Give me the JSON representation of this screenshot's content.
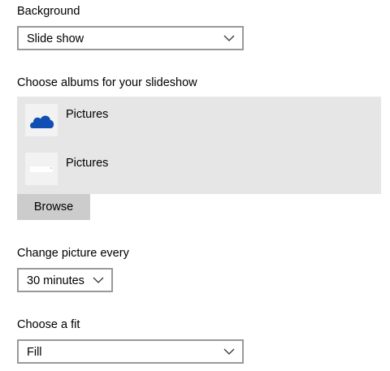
{
  "background": {
    "label": "Background",
    "selected": "Slide show"
  },
  "albums": {
    "label": "Choose albums for your slideshow",
    "items": [
      {
        "name": "Pictures",
        "icon": "onedrive-cloud-icon",
        "icon_color": "#0f4fb4"
      },
      {
        "name": "Pictures",
        "icon": "folder-thumbnail-icon"
      }
    ],
    "browse_label": "Browse"
  },
  "interval": {
    "label": "Change picture every",
    "selected": "30 minutes"
  },
  "fit": {
    "label": "Choose a fit",
    "selected": "Fill"
  }
}
